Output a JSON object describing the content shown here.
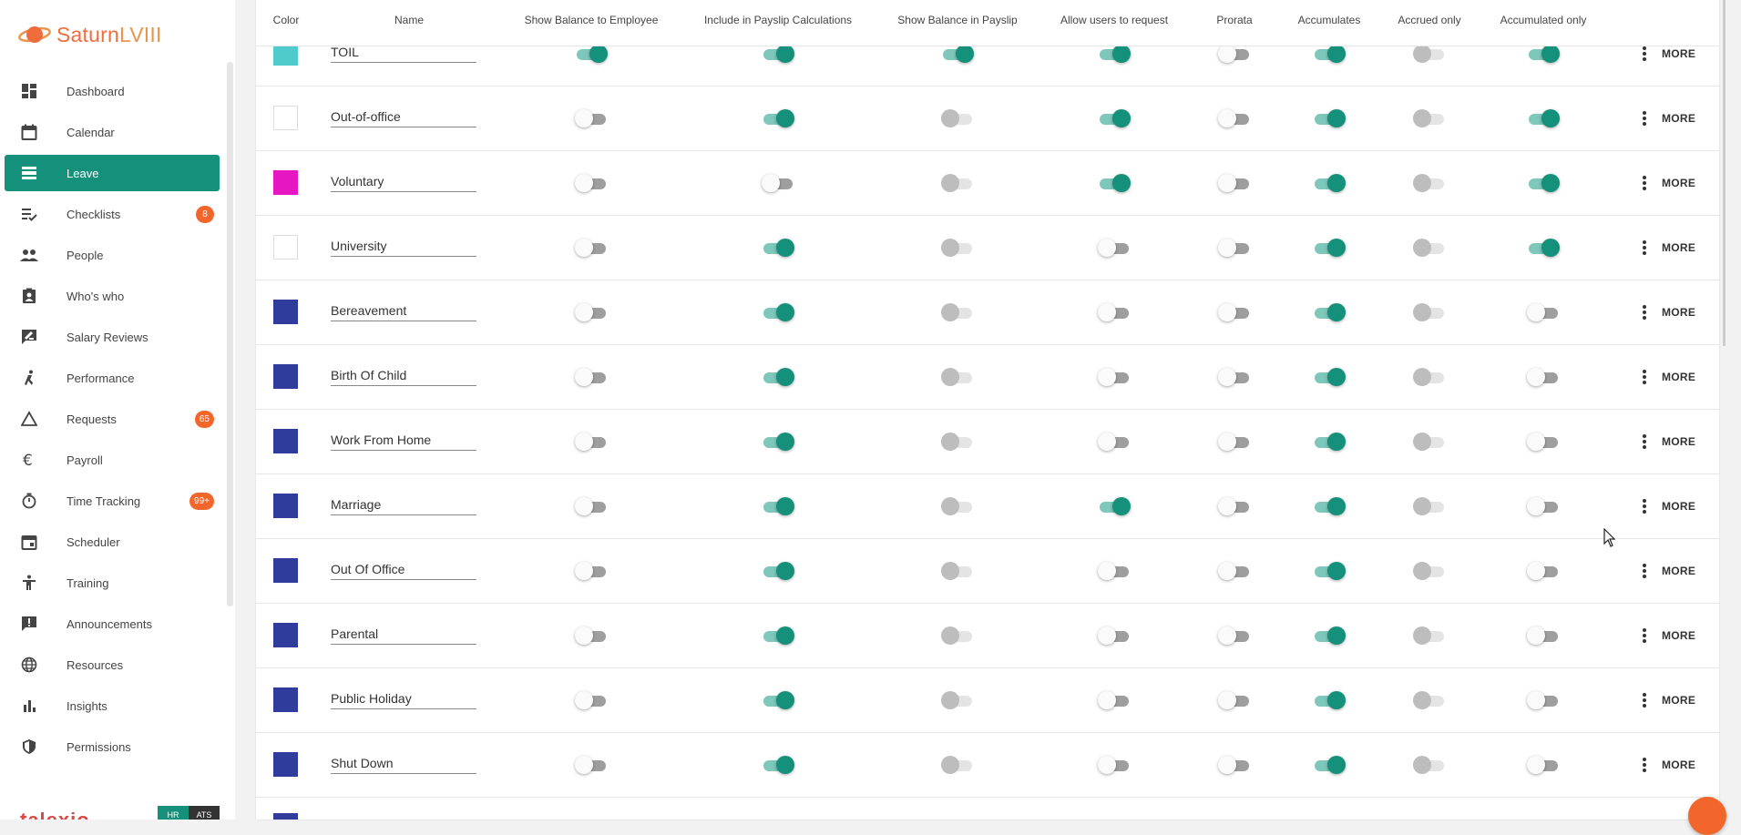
{
  "app": {
    "logo_a": "Saturn",
    "logo_b": "LVIII",
    "brand": "talexio",
    "hr_label": "HR",
    "ats_label": "ATS"
  },
  "colors": {
    "accent": "#15907a",
    "badge": "#f2662c",
    "swatch_toil": "#4fcbcb",
    "swatch_voluntary": "#e617c3",
    "swatch_blue": "#2f3c9c",
    "swatch_white": "#ffffff"
  },
  "sidebar": {
    "items": [
      {
        "label": "Dashboard",
        "icon": "dashboard-icon"
      },
      {
        "label": "Calendar",
        "icon": "calendar-icon"
      },
      {
        "label": "Leave",
        "icon": "leave-icon",
        "active": true
      },
      {
        "label": "Checklists",
        "icon": "checklist-icon",
        "badge": "8"
      },
      {
        "label": "People",
        "icon": "people-icon"
      },
      {
        "label": "Who's who",
        "icon": "contact-card-icon"
      },
      {
        "label": "Salary Reviews",
        "icon": "rate-review-icon"
      },
      {
        "label": "Performance",
        "icon": "runner-icon"
      },
      {
        "label": "Requests",
        "icon": "triangle-icon",
        "badge": "65"
      },
      {
        "label": "Payroll",
        "icon": "euro-icon"
      },
      {
        "label": "Time Tracking",
        "icon": "timer-icon",
        "badge": "99+"
      },
      {
        "label": "Scheduler",
        "icon": "event-icon"
      },
      {
        "label": "Training",
        "icon": "accessibility-icon"
      },
      {
        "label": "Announcements",
        "icon": "announcement-icon"
      },
      {
        "label": "Resources",
        "icon": "globe-icon"
      },
      {
        "label": "Insights",
        "icon": "bar-chart-icon"
      },
      {
        "label": "Permissions",
        "icon": "shield-icon"
      }
    ]
  },
  "table": {
    "headers": [
      "Color",
      "Name",
      "Show Balance to Employee",
      "Include in Payslip Calculations",
      "Show Balance in Payslip",
      "Allow users to request",
      "Prorata",
      "Accumulates",
      "Accrued only",
      "Accumulated only"
    ],
    "more_label": "MORE",
    "rows": [
      {
        "name": "TOIL",
        "color": "#4fcbcb",
        "toggles": [
          "on",
          "on",
          "on",
          "on",
          "off",
          "on",
          "dis",
          "on"
        ]
      },
      {
        "name": "Out-of-office",
        "color": "#ffffff",
        "toggles": [
          "off",
          "on",
          "dis",
          "on",
          "off",
          "on",
          "dis",
          "on"
        ]
      },
      {
        "name": "Voluntary",
        "color": "#e617c3",
        "toggles": [
          "off",
          "off",
          "dis",
          "on",
          "off",
          "on",
          "dis",
          "on"
        ]
      },
      {
        "name": "University",
        "color": "#ffffff",
        "toggles": [
          "off",
          "on",
          "dis",
          "off",
          "off",
          "on",
          "dis",
          "on"
        ]
      },
      {
        "name": "Bereavement",
        "color": "#2f3c9c",
        "toggles": [
          "off",
          "on",
          "dis",
          "off",
          "off",
          "on",
          "dis",
          "off"
        ]
      },
      {
        "name": "Birth Of Child",
        "color": "#2f3c9c",
        "toggles": [
          "off",
          "on",
          "dis",
          "off",
          "off",
          "on",
          "dis",
          "off"
        ]
      },
      {
        "name": "Work From Home",
        "color": "#2f3c9c",
        "toggles": [
          "off",
          "on",
          "dis",
          "off",
          "off",
          "on",
          "dis",
          "off"
        ]
      },
      {
        "name": "Marriage",
        "color": "#2f3c9c",
        "toggles": [
          "off",
          "on",
          "dis",
          "on",
          "off",
          "on",
          "dis",
          "off"
        ]
      },
      {
        "name": "Out Of Office",
        "color": "#2f3c9c",
        "toggles": [
          "off",
          "on",
          "dis",
          "off",
          "off",
          "on",
          "dis",
          "off"
        ]
      },
      {
        "name": "Parental",
        "color": "#2f3c9c",
        "toggles": [
          "off",
          "on",
          "dis",
          "off",
          "off",
          "on",
          "dis",
          "off"
        ]
      },
      {
        "name": "Public Holiday",
        "color": "#2f3c9c",
        "toggles": [
          "off",
          "on",
          "dis",
          "off",
          "off",
          "on",
          "dis",
          "off"
        ]
      },
      {
        "name": "Shut Down",
        "color": "#2f3c9c",
        "toggles": [
          "off",
          "on",
          "dis",
          "off",
          "off",
          "on",
          "dis",
          "off"
        ]
      }
    ]
  }
}
